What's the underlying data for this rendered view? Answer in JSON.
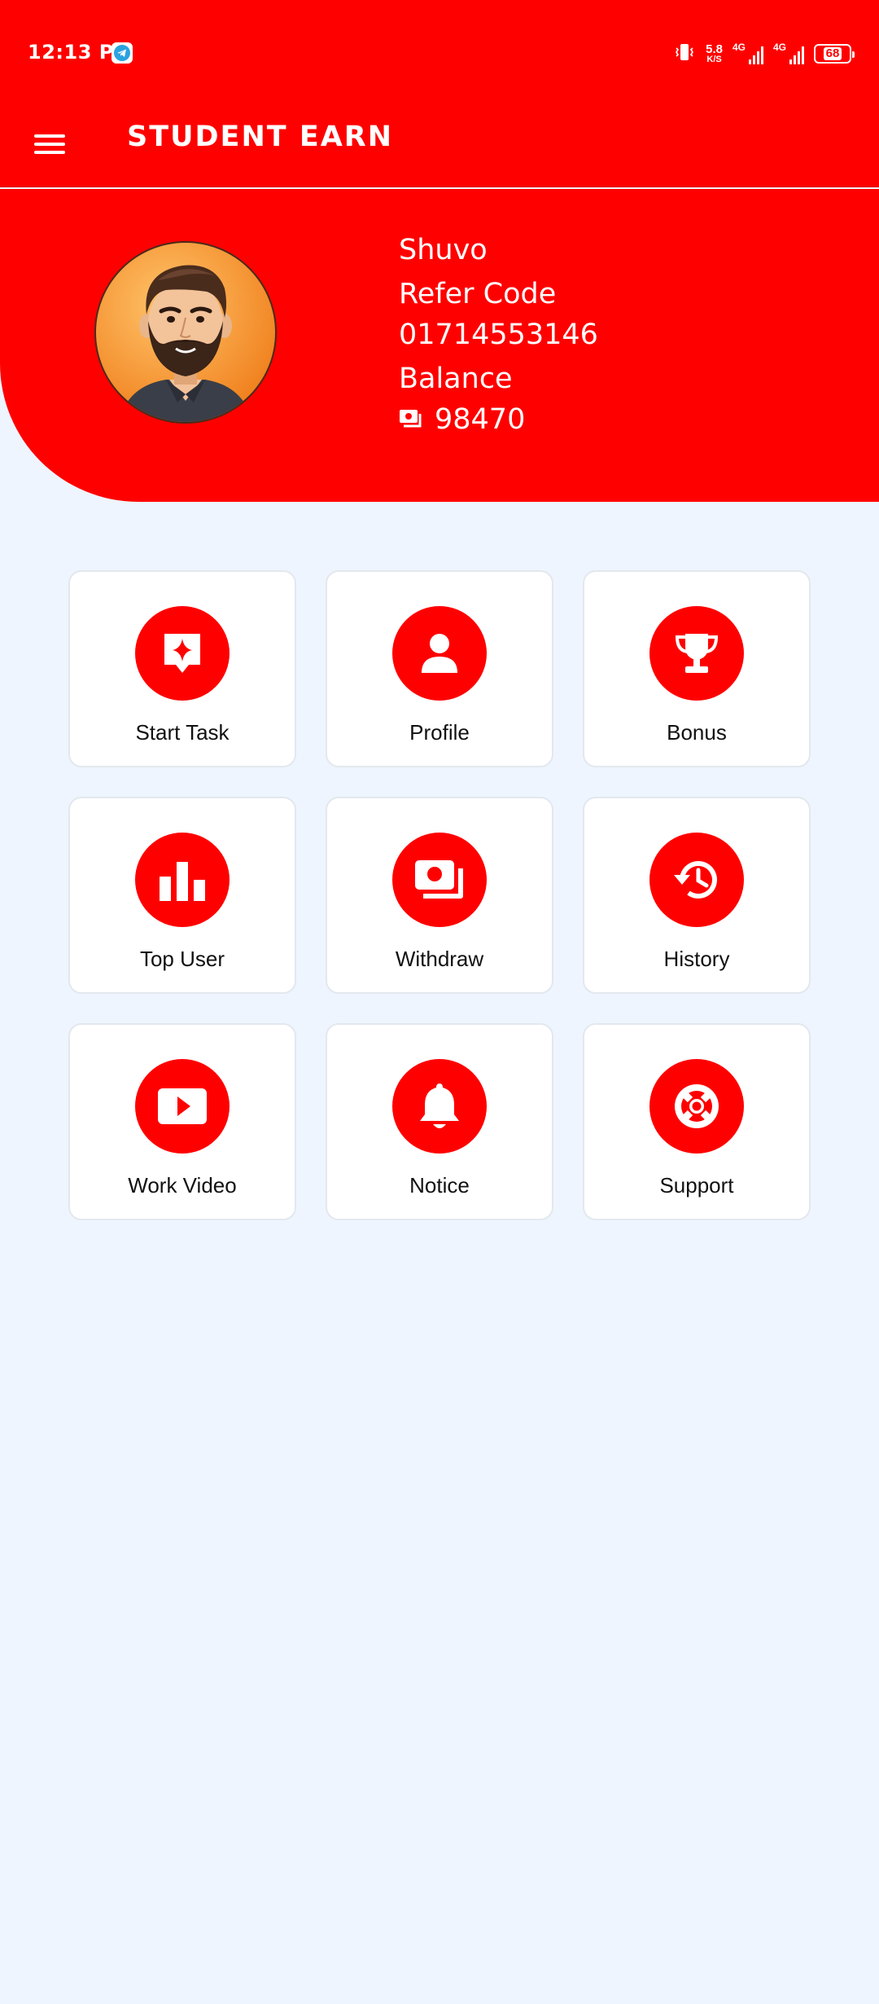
{
  "status_bar": {
    "time": "12:13 PM",
    "net_speed_value": "5.8",
    "net_speed_unit": "K/S",
    "signal_1_label": "4G",
    "signal_2_label": "4G",
    "battery": "68"
  },
  "app": {
    "title": "STUDENT EARN"
  },
  "user": {
    "name": "Shuvo",
    "refer_label": "Refer Code",
    "refer_code": "01714553146",
    "balance_label": "Balance",
    "balance": "98470"
  },
  "menu": [
    {
      "label": "Start Task",
      "icon": "task-icon"
    },
    {
      "label": "Profile",
      "icon": "person-icon"
    },
    {
      "label": "Bonus",
      "icon": "trophy-icon"
    },
    {
      "label": "Top User",
      "icon": "bar-chart-icon"
    },
    {
      "label": "Withdraw",
      "icon": "money-icon"
    },
    {
      "label": "History",
      "icon": "history-icon"
    },
    {
      "label": "Work Video",
      "icon": "video-icon"
    },
    {
      "label": "Notice",
      "icon": "bell-icon"
    },
    {
      "label": "Support",
      "icon": "lifebuoy-icon"
    }
  ],
  "colors": {
    "primary": "#ff0000",
    "background": "#eef5fe",
    "tile": "#ffffff"
  }
}
